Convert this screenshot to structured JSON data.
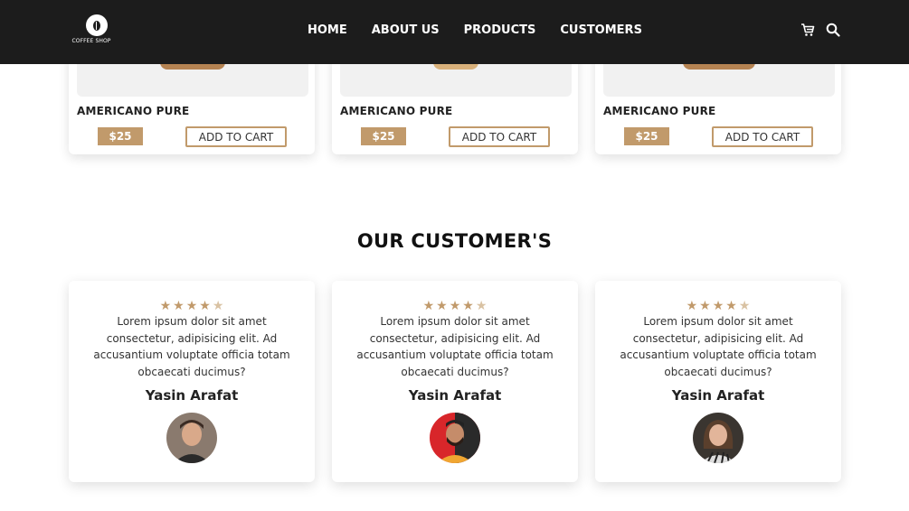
{
  "header": {
    "logo_text": "COFFEE SHOP",
    "nav": [
      "HOME",
      "ABOUT US",
      "PRODUCTS",
      "CUSTOMERS"
    ],
    "icons": [
      "cart-icon",
      "search-icon"
    ]
  },
  "products": [
    {
      "name": "AMERICANO PURE",
      "price": "$25",
      "button": "ADD TO CART"
    },
    {
      "name": "AMERICANO PURE",
      "price": "$25",
      "button": "ADD TO CART"
    },
    {
      "name": "AMERICANO PURE",
      "price": "$25",
      "button": "ADD TO CART"
    }
  ],
  "customers": {
    "title": "OUR CUSTOMER'S",
    "rating": 4.5,
    "reviews": [
      {
        "text": "Lorem ipsum dolor sit amet consectetur, adipisicing elit. Ad accusantium voluptate officia totam obcaecati ducimus?",
        "name": "Yasin Arafat"
      },
      {
        "text": "Lorem ipsum dolor sit amet consectetur, adipisicing elit. Ad accusantium voluptate officia totam obcaecati ducimus?",
        "name": "Yasin Arafat"
      },
      {
        "text": "Lorem ipsum dolor sit amet consectetur, adipisicing elit. Ad accusantium voluptate officia totam obcaecati ducimus?",
        "name": "Yasin Arafat"
      }
    ]
  },
  "colors": {
    "header_bg": "#1c1c1c",
    "accent": "#c19a6b"
  }
}
